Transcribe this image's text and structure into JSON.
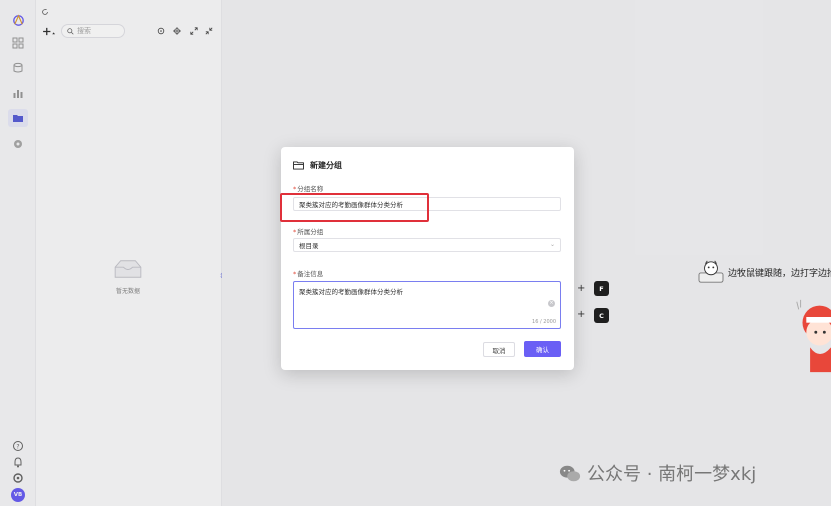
{
  "tree_panel": {
    "search_placeholder": "搜索",
    "empty_text": "暂无数据"
  },
  "dialog": {
    "title": "新建分组",
    "name_label": "分组名称",
    "name_value": "聚类簇对应的考勤画像群体分类分析",
    "parent_label": "所属分组",
    "parent_value": "根目录",
    "remark_label": "备注信息",
    "remark_value": "聚类簇对应的考勤画像群体分类分析",
    "remark_count": "16 / 2000",
    "required_mark": "*",
    "cancel_label": "取消",
    "confirm_label": "确认"
  },
  "shortcuts": {
    "plus": "+",
    "key1": "F",
    "key2": "C"
  },
  "sticker": {
    "text": "边牧鼠键跟随，边打字边抬头"
  },
  "user": {
    "avatar_initials": "VB"
  },
  "watermark": {
    "text": "公众号 · 南柯一梦xkj"
  },
  "colors": {
    "accent": "#6a5ff5",
    "highlight": "#e0303a"
  }
}
